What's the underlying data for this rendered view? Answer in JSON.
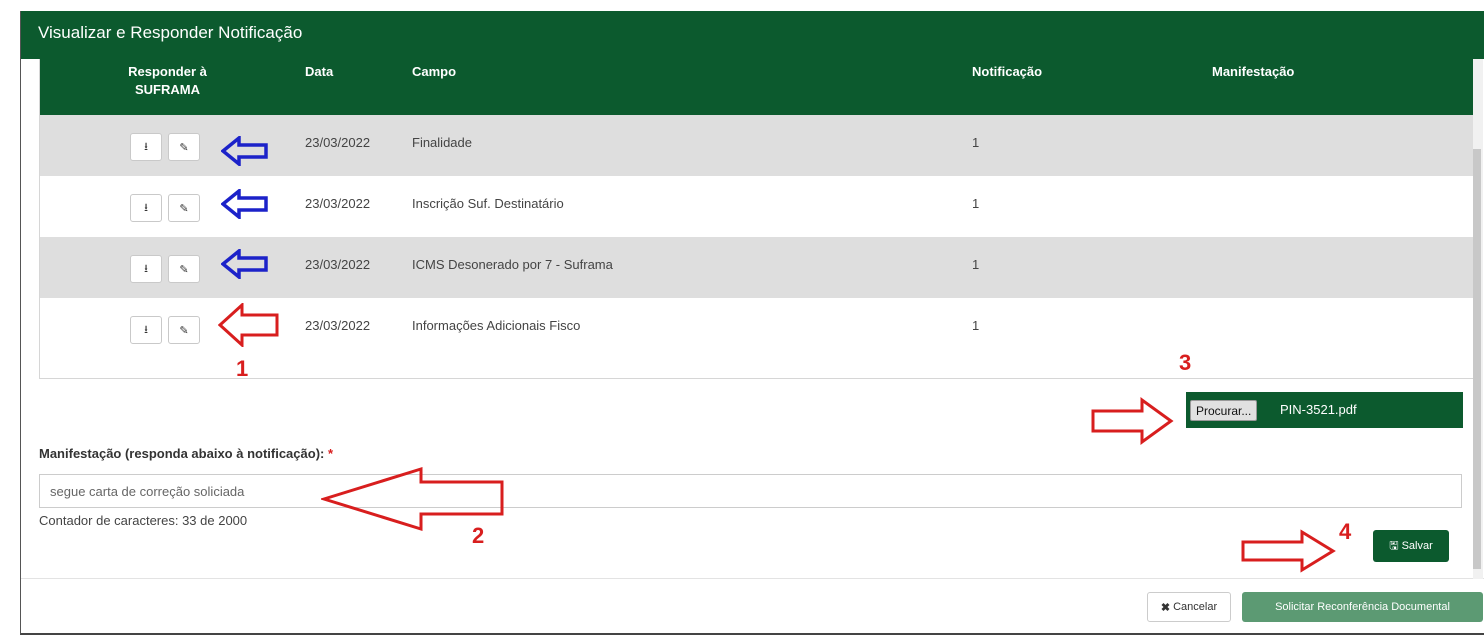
{
  "modal": {
    "title": "Visualizar e Responder Notificação"
  },
  "table": {
    "headers": {
      "responder_line1": "Responder à",
      "responder_line2": "SUFRAMA",
      "data": "Data",
      "campo": "Campo",
      "notificacao": "Notificação",
      "manifestacao": "Manifestação"
    },
    "rows": [
      {
        "data": "23/03/2022",
        "campo": "Finalidade",
        "notificacao": "1",
        "manifestacao": ""
      },
      {
        "data": "23/03/2022",
        "campo": "Inscrição Suf. Destinatário",
        "notificacao": "1",
        "manifestacao": ""
      },
      {
        "data": "23/03/2022",
        "campo": "ICMS Desonerado por 7 - Suframa",
        "notificacao": "1",
        "manifestacao": ""
      },
      {
        "data": "23/03/2022",
        "campo": "Informações Adicionais Fisco",
        "notificacao": "1",
        "manifestacao": ""
      }
    ],
    "row_buttons": {
      "download_icon": "download-icon",
      "edit_icon": "edit-icon"
    }
  },
  "file": {
    "browse_label": "Procurar...",
    "file_name": "PIN-3521.pdf"
  },
  "manifestation": {
    "label": "Manifestação (responda abaixo à notificação):",
    "required_mark": "*",
    "value": "segue carta de correção soliciada",
    "counter": "Contador de caracteres: 33 de 2000"
  },
  "buttons": {
    "save_label": "Salvar",
    "cancel_label": "Cancelar",
    "reconference_label": "Solicitar Reconferência Documental"
  },
  "annotations": {
    "step1": "1",
    "step2": "2",
    "step3": "3",
    "step4": "4"
  },
  "colors": {
    "header_green": "#0c5a2e",
    "row_gray": "#dedede",
    "annotation_red": "#d81e1e",
    "annotation_blue": "#1c22c9",
    "secondary_green": "#5c9a73"
  }
}
